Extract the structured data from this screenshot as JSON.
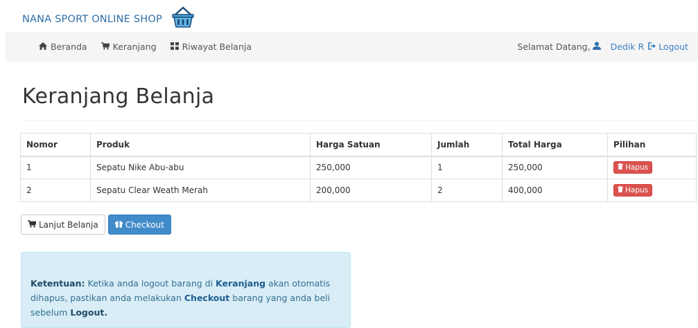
{
  "brand": {
    "title": "NANA SPORT ONLINE SHOP",
    "logo_icon": "shopping-basket-icon"
  },
  "nav": {
    "items": [
      {
        "label": "Beranda",
        "icon": "home-icon"
      },
      {
        "label": "Keranjang",
        "icon": "cart-icon"
      },
      {
        "label": "Riwayat Belanja",
        "icon": "grid-icon"
      }
    ],
    "welcome": "Selamat Datang,",
    "user": "Dedik R",
    "logout": "Logout"
  },
  "page": {
    "title": "Keranjang Belanja"
  },
  "table": {
    "headers": [
      "Nomor",
      "Produk",
      "Harga Satuan",
      "Jumlah",
      "Total Harga",
      "Pilihan"
    ],
    "rows": [
      {
        "no": "1",
        "produk": "Sepatu Nike Abu-abu",
        "harga": "250,000",
        "jumlah": "1",
        "total": "250,000",
        "action": "Hapus"
      },
      {
        "no": "2",
        "produk": "Sepatu Clear Weath Merah",
        "harga": "200,000",
        "jumlah": "2",
        "total": "400,000",
        "action": "Hapus"
      }
    ]
  },
  "actions": {
    "continue_label": "Lanjut Belanja",
    "checkout_label": "Checkout"
  },
  "notice": {
    "label": "Ketentuan:",
    "text1": " Ketika anda logout barang di ",
    "kw_cart": "Keranjang",
    "text2": " akan otomatis dihapus, pastikan anda melakukan ",
    "kw_checkout": "Checkout",
    "text3": " barang yang anda beli sebelum ",
    "kw_logout": "Logout."
  },
  "colors": {
    "brand": "#2f6fa9",
    "primary": "#428bca",
    "danger": "#d9534f",
    "info_bg": "#d9edf7"
  }
}
